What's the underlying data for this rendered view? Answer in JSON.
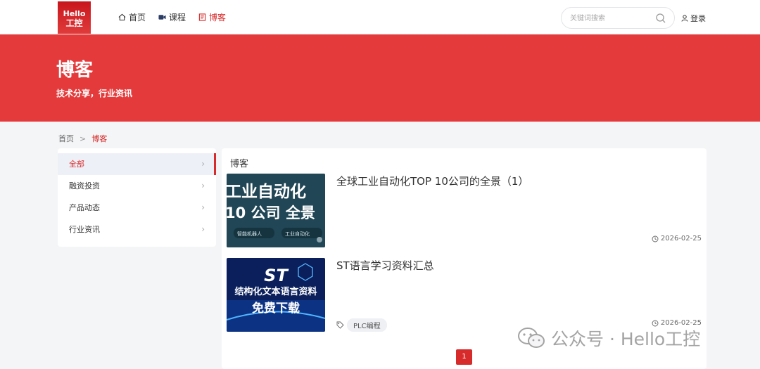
{
  "header": {
    "logo": {
      "line1": "Hello",
      "line2": "工控"
    },
    "nav": [
      {
        "label": "首页",
        "icon": "home-icon",
        "active": false
      },
      {
        "label": "课程",
        "icon": "video-icon",
        "active": false
      },
      {
        "label": "博客",
        "icon": "book-icon",
        "active": true
      }
    ],
    "search": {
      "placeholder": "关键词搜索",
      "icon": "search-icon"
    },
    "login_label": "登录"
  },
  "banner": {
    "title": "博客",
    "subtitle": "技术分享，行业资讯",
    "color": "#e43a3b"
  },
  "breadcrumb": {
    "home": "首页",
    "separator": ">",
    "current": "博客"
  },
  "sidebar": {
    "items": [
      {
        "label": "全部",
        "active": true
      },
      {
        "label": "融资投资",
        "active": false
      },
      {
        "label": "产品动态",
        "active": false
      },
      {
        "label": "行业资讯",
        "active": false
      }
    ]
  },
  "main": {
    "section_title": "博客",
    "articles": [
      {
        "title": "全球工业自动化TOP 10公司的全景（1）",
        "date": "2026-02-25",
        "thumb": {
          "line1": "工业自动化",
          "line2": "10 公司 全景",
          "chip1": "智能机器人",
          "chip2": "工业自动化"
        }
      },
      {
        "title": "ST语言学习资料汇总",
        "date": "2026-02-25",
        "tag": "PLC编程",
        "thumb": {
          "line1": "ST",
          "line2": "结构化文本语言资料",
          "line3": "免费下载"
        }
      }
    ],
    "pagination": {
      "current": "1"
    }
  },
  "watermark": {
    "text": "公众号 · Hello工控"
  },
  "colors": {
    "accent": "#d72b2b",
    "banner": "#e43a3b"
  }
}
